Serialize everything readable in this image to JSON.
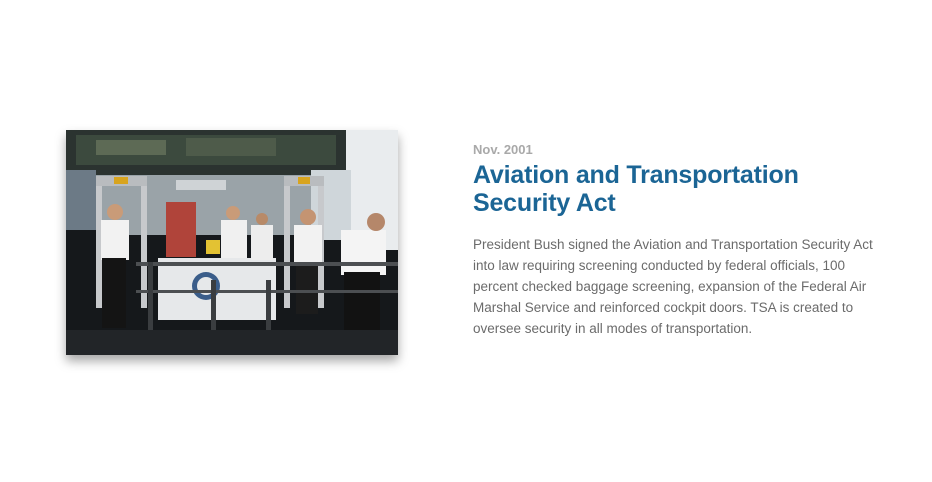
{
  "entry": {
    "date": "Nov. 2001",
    "title": "Aviation and Transportation Security Act",
    "description": "President Bush signed the Aviation and Transportation Security Act into law requiring screening conducted by federal officials, 100 percent checked baggage screening, expansion of the Federal Air Marshal Service and reinforced cockpit doors. TSA is created to oversee security in all modes of transportation."
  },
  "colors": {
    "title": "#1b6595",
    "date": "#a9a9a9",
    "body_text": "#6b6b6b"
  }
}
